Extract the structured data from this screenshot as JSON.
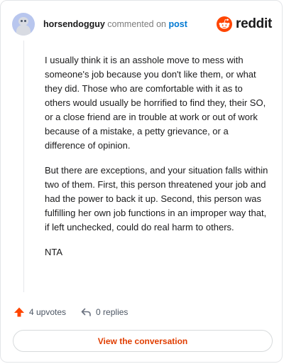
{
  "header": {
    "username": "horsendogguy",
    "commented_text": "commented on",
    "post_link": "post",
    "brand": "reddit"
  },
  "comment": {
    "paragraphs": [
      "I usually think it is an asshole move to mess with someone's job because you don't like them, or what they did. Those who are comfortable with it as to others would usually be horrified to find they, their SO, or a close friend are in trouble at work or out of work because of a mistake, a petty grievance, or a difference of opinion.",
      "But there are exceptions, and your situation falls within two of them. First, this person threatened your job and had the power to back it up. Second, this person was fulfilling her own job functions in an improper way that, if left unchecked, could do real harm to others.",
      "NTA"
    ]
  },
  "actions": {
    "upvotes": "4 upvotes",
    "replies": "0 replies"
  },
  "cta": {
    "label": "View the conversation"
  },
  "colors": {
    "brand_orange": "#ff4500",
    "link_blue": "#0079d3",
    "upvote_orange": "#ff4500",
    "cta_text": "#e03d00"
  },
  "icons": {
    "avatar": "snoo-avatar",
    "logo": "reddit-snoo-logo-icon",
    "upvote": "upvote-arrow-icon",
    "reply": "reply-arrow-icon"
  }
}
